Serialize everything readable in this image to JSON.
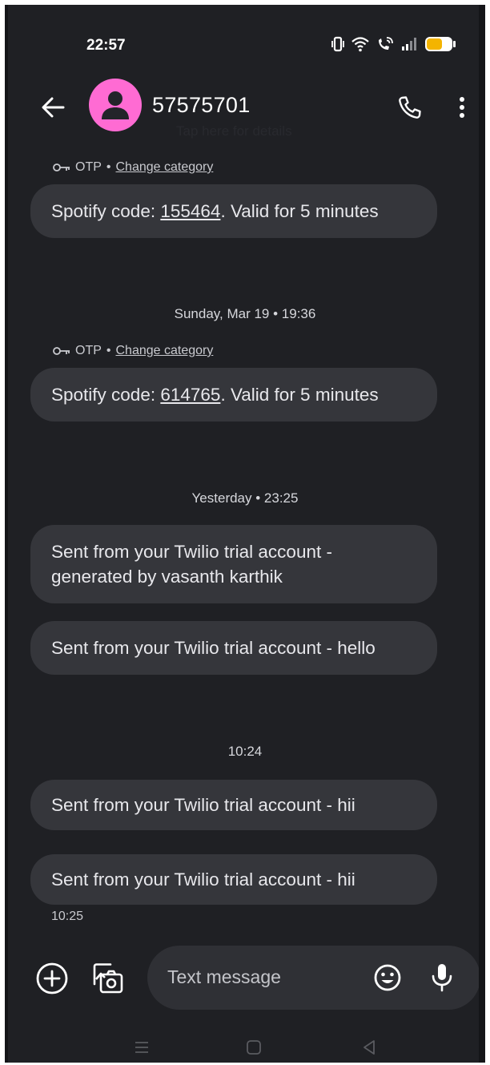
{
  "status_bar": {
    "time": "22:57",
    "icons": [
      "vibrate-icon",
      "wifi-icon",
      "wifi-call-icon",
      "signal-icon",
      "battery-icon"
    ],
    "battery_color": "#f4b400"
  },
  "header": {
    "contact_name": "57575701",
    "subtitle": "Tap here for details",
    "avatar_color": "#ff6bd3"
  },
  "messages": {
    "otp_label": "OTP",
    "change_category": "Change category",
    "msg1": {
      "prefix": "Spotify code: ",
      "code": "155464",
      "suffix": ". Valid for 5 minutes"
    },
    "date_1": "Sunday, Mar 19 • 19:36",
    "msg2": {
      "prefix": "Spotify code: ",
      "code": "614765",
      "suffix": ". Valid for 5 minutes"
    },
    "date_2": "Yesterday • 23:25",
    "msg3": "Sent from your Twilio trial account - generated by vasanth karthik",
    "msg4": "Sent from your Twilio trial account - hello",
    "date_3": "10:24",
    "msg5": "Sent from your Twilio trial account - hii",
    "msg6": "Sent from your Twilio trial account - hii",
    "last_time": "10:25"
  },
  "compose": {
    "placeholder": "Text message"
  }
}
